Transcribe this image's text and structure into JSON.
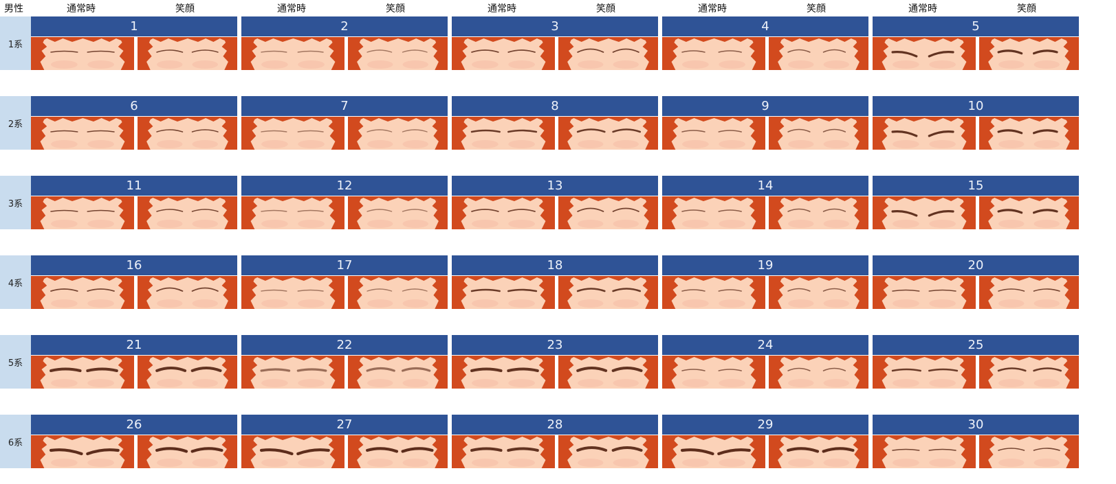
{
  "header": {
    "corner_label": "男性",
    "normal_label": "通常時",
    "smile_label": "笑顔"
  },
  "colors": {
    "header_bar": "#2f5396",
    "row_label_bg": "#c9dcee",
    "hair": "#d24a1e",
    "skin": "#fbd2b8",
    "background": "#8fbcbc",
    "brow": "#5a2a18"
  },
  "rows": [
    {
      "label": "1系",
      "items": [
        {
          "number": "1",
          "brow_style": "thin-flat"
        },
        {
          "number": "2",
          "brow_style": "thin-faint"
        },
        {
          "number": "3",
          "brow_style": "thin-arched"
        },
        {
          "number": "4",
          "brow_style": "thin-short"
        },
        {
          "number": "5",
          "brow_style": "angled-dark"
        }
      ]
    },
    {
      "label": "2系",
      "items": [
        {
          "number": "6",
          "brow_style": "thin-flat"
        },
        {
          "number": "7",
          "brow_style": "thin-faint"
        },
        {
          "number": "8",
          "brow_style": "medium-flat"
        },
        {
          "number": "9",
          "brow_style": "thin-short"
        },
        {
          "number": "10",
          "brow_style": "angled-dark"
        }
      ]
    },
    {
      "label": "3系",
      "items": [
        {
          "number": "11",
          "brow_style": "thin-flat"
        },
        {
          "number": "12",
          "brow_style": "thin-faint"
        },
        {
          "number": "13",
          "brow_style": "thin-arched"
        },
        {
          "number": "14",
          "brow_style": "thin-short"
        },
        {
          "number": "15",
          "brow_style": "angled-dark"
        }
      ]
    },
    {
      "label": "4系",
      "items": [
        {
          "number": "16",
          "brow_style": "thin-arched"
        },
        {
          "number": "17",
          "brow_style": "thin-faint"
        },
        {
          "number": "18",
          "brow_style": "medium-flat"
        },
        {
          "number": "19",
          "brow_style": "thin-short"
        },
        {
          "number": "20",
          "brow_style": "thin-flat"
        }
      ]
    },
    {
      "label": "5系",
      "items": [
        {
          "number": "21",
          "brow_style": "thick-flat"
        },
        {
          "number": "22",
          "brow_style": "thick-faint"
        },
        {
          "number": "23",
          "brow_style": "thick-flat"
        },
        {
          "number": "24",
          "brow_style": "thin-short"
        },
        {
          "number": "25",
          "brow_style": "medium-flat"
        }
      ]
    },
    {
      "label": "6系",
      "items": [
        {
          "number": "26",
          "brow_style": "thick-angled"
        },
        {
          "number": "27",
          "brow_style": "thick-angled"
        },
        {
          "number": "28",
          "brow_style": "thick-flat"
        },
        {
          "number": "29",
          "brow_style": "thick-angled"
        },
        {
          "number": "30",
          "brow_style": "thin-flat"
        }
      ]
    }
  ]
}
